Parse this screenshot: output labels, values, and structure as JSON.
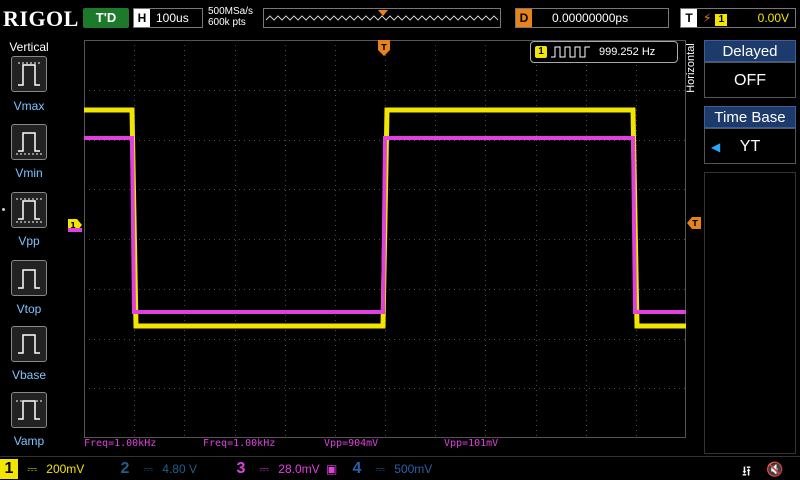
{
  "topbar": {
    "brand": "RIGOL",
    "trigger_status": "T'D",
    "horizontal_tag": "H",
    "timebase": "100us",
    "sample_rate": "500MSa/s",
    "memory_depth": "600k pts",
    "delay_tag": "D",
    "delay_value": "0.00000000ps",
    "trigger_tag": "T",
    "trigger_channel": "1",
    "trigger_level": "0.00V"
  },
  "left_menu": {
    "title": "Vertical",
    "items": [
      {
        "label": "Vmax"
      },
      {
        "label": "Vmin"
      },
      {
        "label": "Vpp"
      },
      {
        "label": "Vtop"
      },
      {
        "label": "Vbase"
      },
      {
        "label": "Vamp"
      }
    ]
  },
  "screen": {
    "freq_counter_channel": "1",
    "freq_counter_value": "999.252 Hz",
    "trigger_marker": "T",
    "ch1_marker": "1"
  },
  "measurements": [
    {
      "text": "Freq=1.00kHz"
    },
    {
      "text": "Freq=1.00kHz"
    },
    {
      "text": "Vpp=904mV"
    },
    {
      "text": "Vpp=101mV"
    }
  ],
  "right_menu": {
    "section_label": "Horizontal",
    "delayed": {
      "title": "Delayed",
      "value": "OFF"
    },
    "timebase": {
      "title": "Time Base",
      "value": "YT"
    }
  },
  "bottombar": {
    "channels": [
      {
        "num": "1",
        "value": "200mV",
        "color": "#f2e600"
      },
      {
        "num": "2",
        "value": "4.80 V",
        "color": "#1f5f8a"
      },
      {
        "num": "3",
        "value": "28.0mV",
        "color": "#e040e0"
      },
      {
        "num": "4",
        "value": "500mV",
        "color": "#2d5fa8"
      }
    ]
  },
  "colors": {
    "ch1": "#f2e600",
    "ch3": "#e040e0",
    "grid": "#4a4a4a",
    "marker": "#e8831a"
  }
}
